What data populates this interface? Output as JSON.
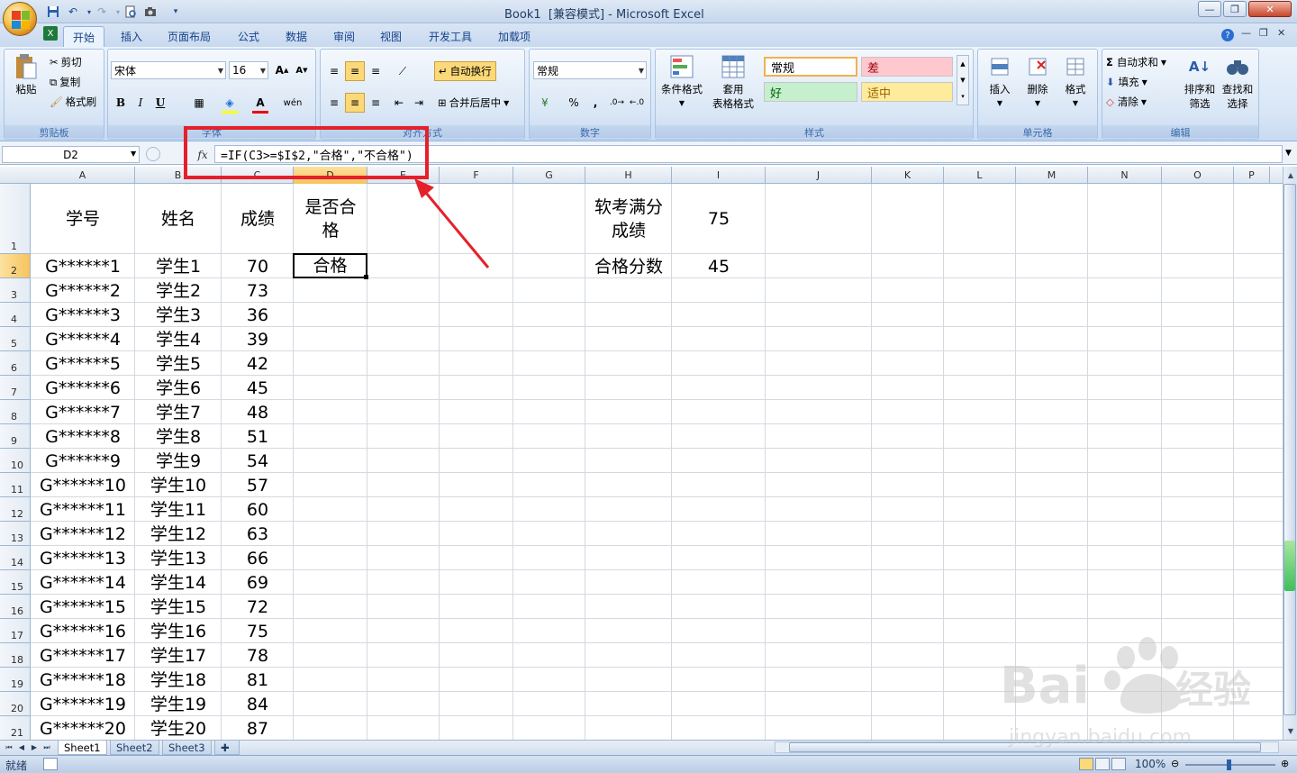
{
  "window": {
    "title": "Book1  [兼容模式] - Microsoft Excel"
  },
  "tabs": [
    {
      "label": "开始"
    },
    {
      "label": "插入"
    },
    {
      "label": "页面布局"
    },
    {
      "label": "公式"
    },
    {
      "label": "数据"
    },
    {
      "label": "审阅"
    },
    {
      "label": "视图"
    },
    {
      "label": "开发工具"
    },
    {
      "label": "加载项"
    }
  ],
  "ribbon": {
    "clipboard": {
      "label": "剪贴板",
      "paste": "粘贴",
      "cut": "剪切",
      "copy": "复制",
      "format_painter": "格式刷"
    },
    "font": {
      "label": "字体",
      "name": "宋体",
      "size": "16",
      "bold": "B",
      "italic": "I",
      "underline": "U"
    },
    "alignment": {
      "label": "对齐方式",
      "wrap": "自动换行",
      "merge": "合并后居中"
    },
    "number": {
      "label": "数字",
      "format": "常规",
      "percent": "%",
      "comma": ","
    },
    "styles": {
      "label": "样式",
      "conditional": "条件格式",
      "table": "套用",
      "table2": "表格格式",
      "normal": "常规",
      "bad": "差",
      "good": "好",
      "neutral": "适中"
    },
    "cells": {
      "label": "单元格",
      "insert": "插入",
      "delete": "删除",
      "format": "格式"
    },
    "editing": {
      "label": "编辑",
      "autosum": "自动求和",
      "fill": "填充",
      "clear": "清除",
      "sort": "排序和",
      "sort2": "筛选",
      "find": "查找和",
      "find2": "选择"
    }
  },
  "formula_bar": {
    "name_box": "D2",
    "fx": "fx",
    "formula": "=IF(C3>=$I$2,\"合格\",\"不合格\")"
  },
  "columns": [
    "A",
    "B",
    "C",
    "D",
    "E",
    "F",
    "G",
    "H",
    "I",
    "J",
    "K",
    "L",
    "M",
    "N",
    "O",
    "P"
  ],
  "rows": [
    "1",
    "2",
    "3",
    "4",
    "5",
    "6",
    "7",
    "8",
    "9",
    "10",
    "11",
    "12",
    "13",
    "14",
    "15",
    "16",
    "17",
    "18",
    "19",
    "20",
    "21"
  ],
  "header_cells": {
    "a1": "学号",
    "b1": "姓名",
    "c1": "成绩",
    "d1": "是否合格",
    "h1": "软考满分成绩",
    "i1": "75",
    "h2": "合格分数",
    "i2": "45"
  },
  "active_cell": {
    "value": "合格"
  },
  "table": [
    [
      "G******1",
      "学生1",
      "70"
    ],
    [
      "G******2",
      "学生2",
      "73"
    ],
    [
      "G******3",
      "学生3",
      "36"
    ],
    [
      "G******4",
      "学生4",
      "39"
    ],
    [
      "G******5",
      "学生5",
      "42"
    ],
    [
      "G******6",
      "学生6",
      "45"
    ],
    [
      "G******7",
      "学生7",
      "48"
    ],
    [
      "G******8",
      "学生8",
      "51"
    ],
    [
      "G******9",
      "学生9",
      "54"
    ],
    [
      "G******10",
      "学生10",
      "57"
    ],
    [
      "G******11",
      "学生11",
      "60"
    ],
    [
      "G******12",
      "学生12",
      "63"
    ],
    [
      "G******13",
      "学生13",
      "66"
    ],
    [
      "G******14",
      "学生14",
      "69"
    ],
    [
      "G******15",
      "学生15",
      "72"
    ],
    [
      "G******16",
      "学生16",
      "75"
    ],
    [
      "G******17",
      "学生17",
      "78"
    ],
    [
      "G******18",
      "学生18",
      "81"
    ],
    [
      "G******19",
      "学生19",
      "84"
    ],
    [
      "G******20",
      "学生20",
      "87"
    ]
  ],
  "sheet_tabs": [
    {
      "label": "Sheet1"
    },
    {
      "label": "Sheet2"
    },
    {
      "label": "Sheet3"
    }
  ],
  "status": {
    "ready": "就绪",
    "zoom": "100%"
  },
  "watermark": {
    "text": "Baidu经验",
    "url": "jingyan.baidu.com"
  },
  "colors": {
    "annotation": "#e5202a",
    "selection_header": "#f7c35d",
    "accent": "#15428b"
  }
}
